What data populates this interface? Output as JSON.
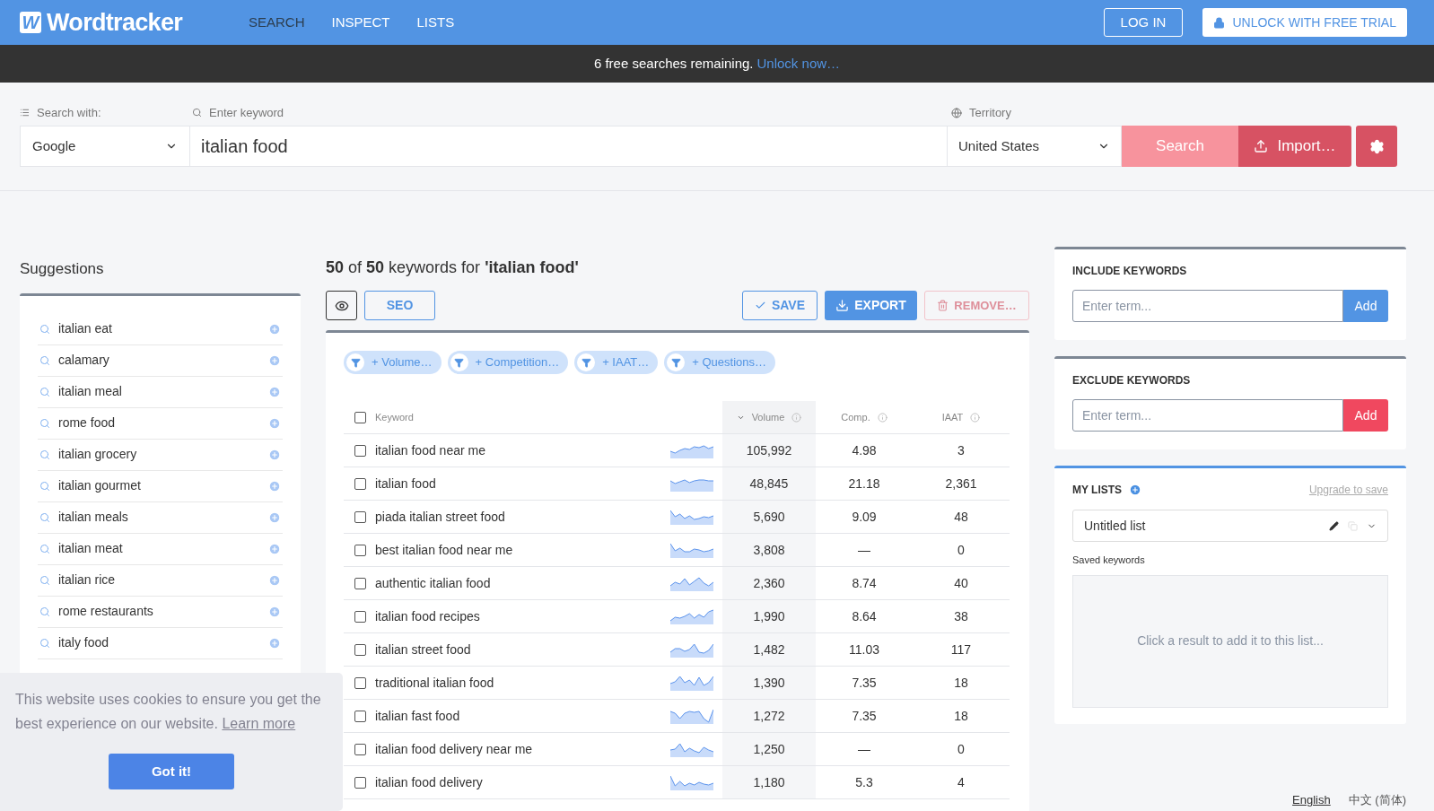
{
  "header": {
    "logo_mark": "W",
    "logo_text": "Wordtracker",
    "nav": [
      {
        "label": "SEARCH",
        "selected": true
      },
      {
        "label": "INSPECT",
        "selected": false
      },
      {
        "label": "LISTS",
        "selected": false
      }
    ],
    "login": "LOG IN",
    "unlock": "UNLOCK WITH FREE TRIAL"
  },
  "notice": {
    "text": "6 free searches remaining.",
    "link": "Unlock now…"
  },
  "search": {
    "engine_label": "Search with:",
    "engine": "Google",
    "keyword_label": "Enter keyword",
    "keyword": "italian food",
    "territory_label": "Territory",
    "territory": "United States",
    "search_button": "Search",
    "import_button": "Import…"
  },
  "suggestions": {
    "title": "Suggestions",
    "items": [
      "italian eat",
      "calamary",
      "italian meal",
      "rome food",
      "italian grocery",
      "italian gourmet",
      "italian meals",
      "italian meat",
      "italian rice",
      "rome restaurants",
      "italy food"
    ]
  },
  "results": {
    "count": "**50** of **50** keywords for **'italian food'**",
    "seo": "SEO",
    "save": "SAVE",
    "export": "EXPORT",
    "remove": "REMOVE…",
    "remove_disabled": true,
    "select_all_checked": false,
    "filters": [
      "+ Volume…",
      "+ Competition…",
      "+ IAAT…",
      "+ Questions…"
    ],
    "columns": [
      {
        "label": "Keyword",
        "sorted": false
      },
      {
        "label": "Volume",
        "sorted": true
      },
      {
        "label": "Comp.",
        "sorted": false
      },
      {
        "label": "IAAT",
        "sorted": false
      }
    ],
    "rows": [
      {
        "keyword": "italian food near me",
        "volume": "105,992",
        "comp": "4.98",
        "iaat": "3",
        "checked": false
      },
      {
        "keyword": "italian food",
        "volume": "48,845",
        "comp": "21.18",
        "iaat": "2,361",
        "checked": false
      },
      {
        "keyword": "piada italian street food",
        "volume": "5,690",
        "comp": "9.09",
        "iaat": "48",
        "checked": false
      },
      {
        "keyword": "best italian food near me",
        "volume": "3,808",
        "comp": "—",
        "iaat": "0",
        "checked": false
      },
      {
        "keyword": "authentic italian food",
        "volume": "2,360",
        "comp": "8.74",
        "iaat": "40",
        "checked": false
      },
      {
        "keyword": "italian food recipes",
        "volume": "1,990",
        "comp": "8.64",
        "iaat": "38",
        "checked": false
      },
      {
        "keyword": "italian street food",
        "volume": "1,482",
        "comp": "11.03",
        "iaat": "117",
        "checked": false
      },
      {
        "keyword": "traditional italian food",
        "volume": "1,390",
        "comp": "7.35",
        "iaat": "18",
        "checked": false
      },
      {
        "keyword": "italian fast food",
        "volume": "1,272",
        "comp": "7.35",
        "iaat": "18",
        "checked": false
      },
      {
        "keyword": "italian food delivery near me",
        "volume": "1,250",
        "comp": "—",
        "iaat": "0",
        "checked": false
      },
      {
        "keyword": "italian food delivery",
        "volume": "1,180",
        "comp": "5.3",
        "iaat": "4",
        "checked": false
      }
    ]
  },
  "include": {
    "title": "INCLUDE KEYWORDS",
    "placeholder": "Enter term...",
    "button": "Add"
  },
  "exclude": {
    "title": "EXCLUDE KEYWORDS",
    "placeholder": "Enter term...",
    "button": "Add"
  },
  "my_lists": {
    "title": "MY LISTS",
    "upgrade": "Upgrade to save",
    "list_name": "Untitled list",
    "saved_label": "Saved keywords",
    "empty": "Click a result to add it to this list..."
  },
  "cookie": {
    "text": "This website uses cookies to ensure you get the best experience on our website.",
    "link": "Learn more",
    "button": "Got it!"
  },
  "footer": {
    "languages": [
      {
        "label": "English",
        "selected": true
      },
      {
        "label": "中文 (简体)",
        "selected": false
      }
    ]
  }
}
